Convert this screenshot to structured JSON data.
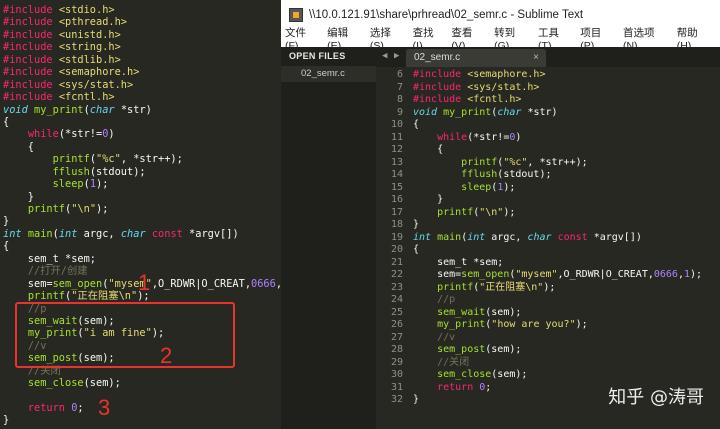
{
  "left_editor": {
    "lines": [
      [
        [
          "kw",
          "#include"
        ],
        [
          "txt",
          " "
        ],
        [
          "str",
          "<stdio.h>"
        ]
      ],
      [
        [
          "kw",
          "#include"
        ],
        [
          "txt",
          " "
        ],
        [
          "str",
          "<pthread.h>"
        ]
      ],
      [
        [
          "kw",
          "#include"
        ],
        [
          "txt",
          " "
        ],
        [
          "str",
          "<unistd.h>"
        ]
      ],
      [
        [
          "kw",
          "#include"
        ],
        [
          "txt",
          " "
        ],
        [
          "str",
          "<string.h>"
        ]
      ],
      [
        [
          "kw",
          "#include"
        ],
        [
          "txt",
          " "
        ],
        [
          "str",
          "<stdlib.h>"
        ]
      ],
      [
        [
          "kw",
          "#include"
        ],
        [
          "txt",
          " "
        ],
        [
          "str",
          "<semaphore.h>"
        ]
      ],
      [
        [
          "kw",
          "#include"
        ],
        [
          "txt",
          " "
        ],
        [
          "str",
          "<sys/stat.h>"
        ]
      ],
      [
        [
          "kw",
          "#include"
        ],
        [
          "txt",
          " "
        ],
        [
          "str",
          "<fcntl.h>"
        ]
      ],
      [
        [
          "ty",
          "void"
        ],
        [
          "txt",
          " "
        ],
        [
          "fn",
          "my_print"
        ],
        [
          "txt",
          "("
        ],
        [
          "ty",
          "char"
        ],
        [
          "txt",
          " *str)"
        ]
      ],
      [
        [
          "txt",
          "{"
        ]
      ],
      [
        [
          "txt",
          "    "
        ],
        [
          "kw",
          "while"
        ],
        [
          "txt",
          "(*str!="
        ],
        [
          "num",
          "0"
        ],
        [
          "txt",
          ")"
        ]
      ],
      [
        [
          "txt",
          "    {"
        ]
      ],
      [
        [
          "txt",
          "        "
        ],
        [
          "fn",
          "printf"
        ],
        [
          "txt",
          "("
        ],
        [
          "str",
          "\"%c\""
        ],
        [
          "txt",
          ", *str++);"
        ]
      ],
      [
        [
          "txt",
          "        "
        ],
        [
          "fn",
          "fflush"
        ],
        [
          "txt",
          "(stdout);"
        ]
      ],
      [
        [
          "txt",
          "        "
        ],
        [
          "fn",
          "sleep"
        ],
        [
          "txt",
          "("
        ],
        [
          "num",
          "1"
        ],
        [
          "txt",
          ");"
        ]
      ],
      [
        [
          "txt",
          "    }"
        ]
      ],
      [
        [
          "txt",
          "    "
        ],
        [
          "fn",
          "printf"
        ],
        [
          "txt",
          "("
        ],
        [
          "str",
          "\"\\n\""
        ],
        [
          "txt",
          ");"
        ]
      ],
      [
        [
          "txt",
          "}"
        ]
      ],
      [
        [
          "ty",
          "int"
        ],
        [
          "txt",
          " "
        ],
        [
          "fn",
          "main"
        ],
        [
          "txt",
          "("
        ],
        [
          "ty",
          "int"
        ],
        [
          "txt",
          " argc, "
        ],
        [
          "ty",
          "char"
        ],
        [
          "txt",
          " "
        ],
        [
          "kw",
          "const"
        ],
        [
          "txt",
          " *argv[])"
        ]
      ],
      [
        [
          "txt",
          "{"
        ]
      ],
      [
        [
          "txt",
          "    sem_t *sem;"
        ]
      ],
      [
        [
          "txt",
          "    "
        ],
        [
          "cm",
          "//打开/创建"
        ]
      ],
      [
        [
          "txt",
          "    sem="
        ],
        [
          "fn",
          "sem_open"
        ],
        [
          "txt",
          "("
        ],
        [
          "str",
          "\"mysem\""
        ],
        [
          "txt",
          ",O_RDWR|O_CREAT,"
        ],
        [
          "num",
          "0666"
        ],
        [
          "txt",
          ","
        ],
        [
          "num",
          "1"
        ],
        [
          "txt",
          ");"
        ]
      ],
      [
        [
          "txt",
          "    "
        ],
        [
          "fn",
          "printf"
        ],
        [
          "txt",
          "("
        ],
        [
          "str",
          "\"正在阻塞\\n\""
        ],
        [
          "txt",
          ");"
        ]
      ],
      [
        [
          "txt",
          "    "
        ],
        [
          "cm",
          "//p"
        ]
      ],
      [
        [
          "txt",
          "    "
        ],
        [
          "fn",
          "sem_wait"
        ],
        [
          "txt",
          "(sem);"
        ]
      ],
      [
        [
          "txt",
          "    "
        ],
        [
          "fn",
          "my_print"
        ],
        [
          "txt",
          "("
        ],
        [
          "str",
          "\"i am fine\""
        ],
        [
          "txt",
          ");"
        ]
      ],
      [
        [
          "txt",
          "    "
        ],
        [
          "cm",
          "//v"
        ]
      ],
      [
        [
          "txt",
          "    "
        ],
        [
          "fn",
          "sem_post"
        ],
        [
          "txt",
          "(sem);"
        ]
      ],
      [
        [
          "txt",
          "    "
        ],
        [
          "cm",
          "//关闭"
        ]
      ],
      [
        [
          "txt",
          "    "
        ],
        [
          "fn",
          "sem_close"
        ],
        [
          "txt",
          "(sem);"
        ]
      ],
      [
        [
          "txt",
          ""
        ]
      ],
      [
        [
          "txt",
          "    "
        ],
        [
          "kw",
          "return"
        ],
        [
          "txt",
          " "
        ],
        [
          "num",
          "0"
        ],
        [
          "txt",
          ";"
        ]
      ],
      [
        [
          "txt",
          "}"
        ]
      ]
    ]
  },
  "annotations": {
    "n1": "1",
    "n2": "2",
    "n3": "3"
  },
  "window": {
    "title": "\\\\10.0.121.91\\share\\prhread\\02_semr.c - Sublime Text",
    "menu": [
      "文件(F)",
      "编辑(E)",
      "选择(S)",
      "查找(I)",
      "查看(V)",
      "转到(G)",
      "工具(T)",
      "项目(P)",
      "首选项(N)",
      "帮助(H)"
    ]
  },
  "sidebar": {
    "header": "OPEN FILES",
    "file": "02_semr.c"
  },
  "tab": {
    "label": "02_semr.c",
    "close": "×",
    "nav_left": "◀",
    "nav_right": "▶"
  },
  "right_editor": {
    "line_numbers": [
      6,
      7,
      8,
      9,
      10,
      11,
      12,
      13,
      14,
      15,
      16,
      17,
      18,
      19,
      20,
      21,
      22,
      23,
      24,
      25,
      26,
      27,
      28,
      29,
      30,
      31,
      32
    ],
    "lines": [
      [
        [
          "kw",
          "#include"
        ],
        [
          "txt",
          " "
        ],
        [
          "str",
          "<semaphore.h>"
        ]
      ],
      [
        [
          "kw",
          "#include"
        ],
        [
          "txt",
          " "
        ],
        [
          "str",
          "<sys/stat.h>"
        ]
      ],
      [
        [
          "kw",
          "#include"
        ],
        [
          "txt",
          " "
        ],
        [
          "str",
          "<fcntl.h>"
        ]
      ],
      [
        [
          "ty",
          "void"
        ],
        [
          "txt",
          " "
        ],
        [
          "fn",
          "my_print"
        ],
        [
          "txt",
          "("
        ],
        [
          "ty",
          "char"
        ],
        [
          "txt",
          " *str)"
        ]
      ],
      [
        [
          "txt",
          "{"
        ]
      ],
      [
        [
          "txt",
          "    "
        ],
        [
          "kw",
          "while"
        ],
        [
          "txt",
          "(*str!="
        ],
        [
          "num",
          "0"
        ],
        [
          "txt",
          ")"
        ]
      ],
      [
        [
          "txt",
          "    {"
        ]
      ],
      [
        [
          "txt",
          "        "
        ],
        [
          "fn",
          "printf"
        ],
        [
          "txt",
          "("
        ],
        [
          "str",
          "\"%c\""
        ],
        [
          "txt",
          ", *str++);"
        ]
      ],
      [
        [
          "txt",
          "        "
        ],
        [
          "fn",
          "fflush"
        ],
        [
          "txt",
          "(stdout);"
        ]
      ],
      [
        [
          "txt",
          "        "
        ],
        [
          "fn",
          "sleep"
        ],
        [
          "txt",
          "("
        ],
        [
          "num",
          "1"
        ],
        [
          "txt",
          ");"
        ]
      ],
      [
        [
          "txt",
          "    }"
        ]
      ],
      [
        [
          "txt",
          "    "
        ],
        [
          "fn",
          "printf"
        ],
        [
          "txt",
          "("
        ],
        [
          "str",
          "\"\\n\""
        ],
        [
          "txt",
          ");"
        ]
      ],
      [
        [
          "txt",
          "}"
        ]
      ],
      [
        [
          "ty",
          "int"
        ],
        [
          "txt",
          " "
        ],
        [
          "fn",
          "main"
        ],
        [
          "txt",
          "("
        ],
        [
          "ty",
          "int"
        ],
        [
          "txt",
          " argc, "
        ],
        [
          "ty",
          "char"
        ],
        [
          "txt",
          " "
        ],
        [
          "kw",
          "const"
        ],
        [
          "txt",
          " *argv[])"
        ]
      ],
      [
        [
          "txt",
          "{"
        ]
      ],
      [
        [
          "txt",
          "    sem_t *sem;"
        ]
      ],
      [
        [
          "txt",
          "    sem="
        ],
        [
          "fn",
          "sem_open"
        ],
        [
          "txt",
          "("
        ],
        [
          "str",
          "\"mysem\""
        ],
        [
          "txt",
          ",O_RDWR|O_CREAT,"
        ],
        [
          "num",
          "0666"
        ],
        [
          "txt",
          ","
        ],
        [
          "num",
          "1"
        ],
        [
          "txt",
          ");"
        ]
      ],
      [
        [
          "txt",
          "    "
        ],
        [
          "fn",
          "printf"
        ],
        [
          "txt",
          "("
        ],
        [
          "str",
          "\"正在阻塞\\n\""
        ],
        [
          "txt",
          ");"
        ]
      ],
      [
        [
          "txt",
          "    "
        ],
        [
          "cm",
          "//p"
        ]
      ],
      [
        [
          "txt",
          "    "
        ],
        [
          "fn",
          "sem_wait"
        ],
        [
          "txt",
          "(sem);"
        ]
      ],
      [
        [
          "txt",
          "    "
        ],
        [
          "fn",
          "my_print"
        ],
        [
          "txt",
          "("
        ],
        [
          "str",
          "\"how are you?\""
        ],
        [
          "txt",
          ");"
        ]
      ],
      [
        [
          "txt",
          "    "
        ],
        [
          "cm",
          "//v"
        ]
      ],
      [
        [
          "txt",
          "    "
        ],
        [
          "fn",
          "sem_post"
        ],
        [
          "txt",
          "(sem);"
        ]
      ],
      [
        [
          "txt",
          "    "
        ],
        [
          "cm",
          "//关闭"
        ]
      ],
      [
        [
          "txt",
          "    "
        ],
        [
          "fn",
          "sem_close"
        ],
        [
          "txt",
          "(sem);"
        ]
      ],
      [
        [
          "txt",
          "    "
        ],
        [
          "kw",
          "return"
        ],
        [
          "txt",
          " "
        ],
        [
          "num",
          "0"
        ],
        [
          "txt",
          ";"
        ]
      ],
      [
        [
          "txt",
          "}"
        ]
      ]
    ]
  },
  "watermark": "知乎 @涛哥",
  "colors": {
    "bg": "#272822",
    "keyword": "#f92672",
    "type": "#66d9ef",
    "function": "#a6e22e",
    "string": "#e6db74",
    "number": "#ae81ff",
    "comment": "#75715e",
    "annotation": "#e8342a"
  }
}
